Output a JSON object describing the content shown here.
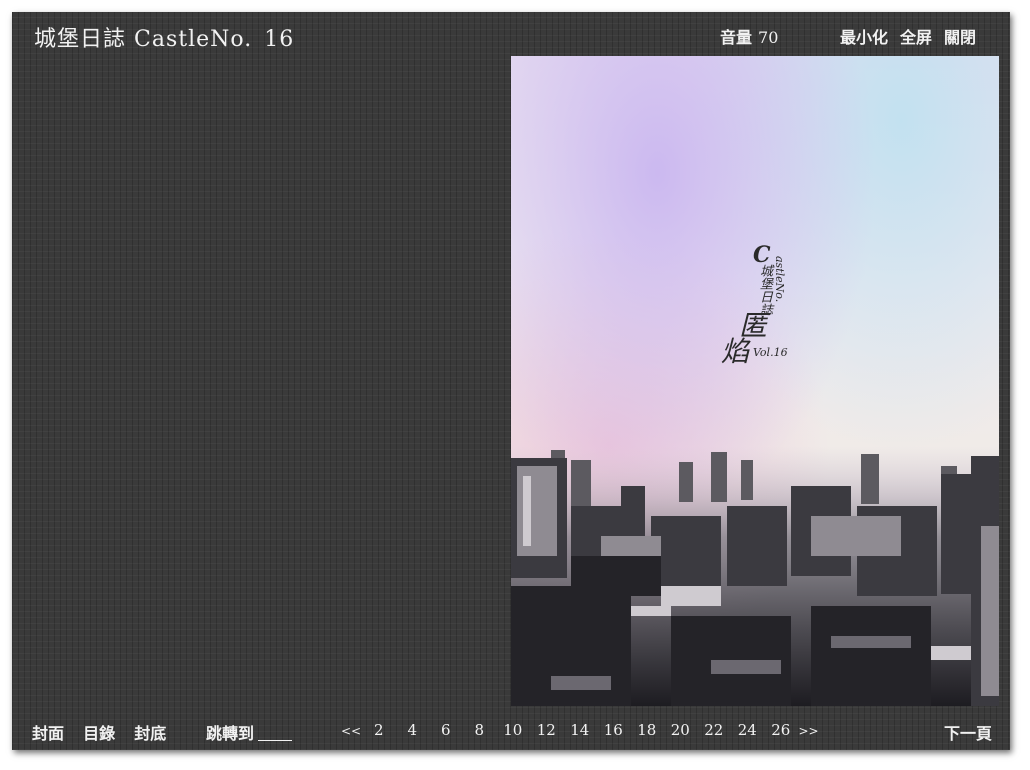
{
  "header": {
    "title": "城堡日誌 CastleNo.",
    "issue_number": "16",
    "volume_label": "音量",
    "volume_value": "70",
    "minimize_label": "最小化",
    "fullscreen_label": "全屏",
    "close_label": "關閉"
  },
  "cover": {
    "logo_c": "C",
    "logo_vertical_cn": "城堡日誌",
    "logo_vertical_en": "astleNo.",
    "logo_big_1": "匿",
    "logo_big_2": "焰",
    "logo_vol": "Vol.16"
  },
  "footer": {
    "front_cover": "封面",
    "contents": "目錄",
    "back_cover": "封底",
    "jump_to": "跳轉到",
    "jump_value": "",
    "prev_arrow": "<<",
    "pages": [
      "2",
      "4",
      "6",
      "8",
      "10",
      "12",
      "14",
      "16",
      "18",
      "20",
      "22",
      "24",
      "26"
    ],
    "next_arrow": ">>",
    "next_page": "下一頁"
  }
}
